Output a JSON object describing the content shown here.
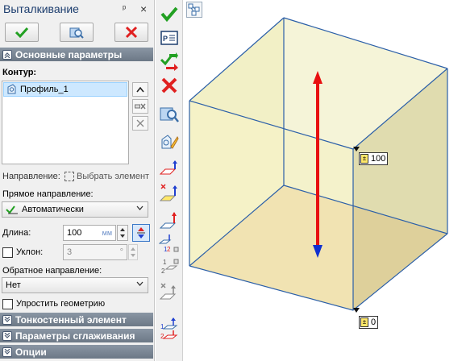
{
  "panel": {
    "title": "Выталкивание",
    "pin_glyph": "ᵖ",
    "close_glyph": "×",
    "sections": {
      "main": "Основные параметры",
      "thin_wall": "Тонкостенный элемент",
      "smoothing": "Параметры сглаживания",
      "options": "Опции"
    },
    "contour_label": "Контур:",
    "contour_items": [
      "Профиль_1"
    ],
    "direction_label": "Направление:",
    "direction_placeholder": "Выбрать элемент",
    "forward_label": "Прямое направление:",
    "forward_value": "Автоматически",
    "length_label": "Длина:",
    "length_value": "100",
    "length_unit": "мм",
    "draft_label": "Уклон:",
    "draft_value": "3",
    "draft_unit": "°",
    "reverse_label": "Обратное направление:",
    "reverse_value": "Нет",
    "simplify_label": "Упростить геометрию"
  },
  "viewport": {
    "dim_top": "100",
    "dim_bottom": "0"
  },
  "colors": {
    "box_top_face": "#e9e6a8",
    "box_side_face": "#d8d39b",
    "box_bottom_face": "#f3c19b",
    "edge": "#2b5fa8",
    "arrow_up": "#e81010",
    "arrow_down": "#1030d0",
    "header": "#7c8896",
    "accent_green": "#22a022",
    "accent_red": "#e02020"
  }
}
